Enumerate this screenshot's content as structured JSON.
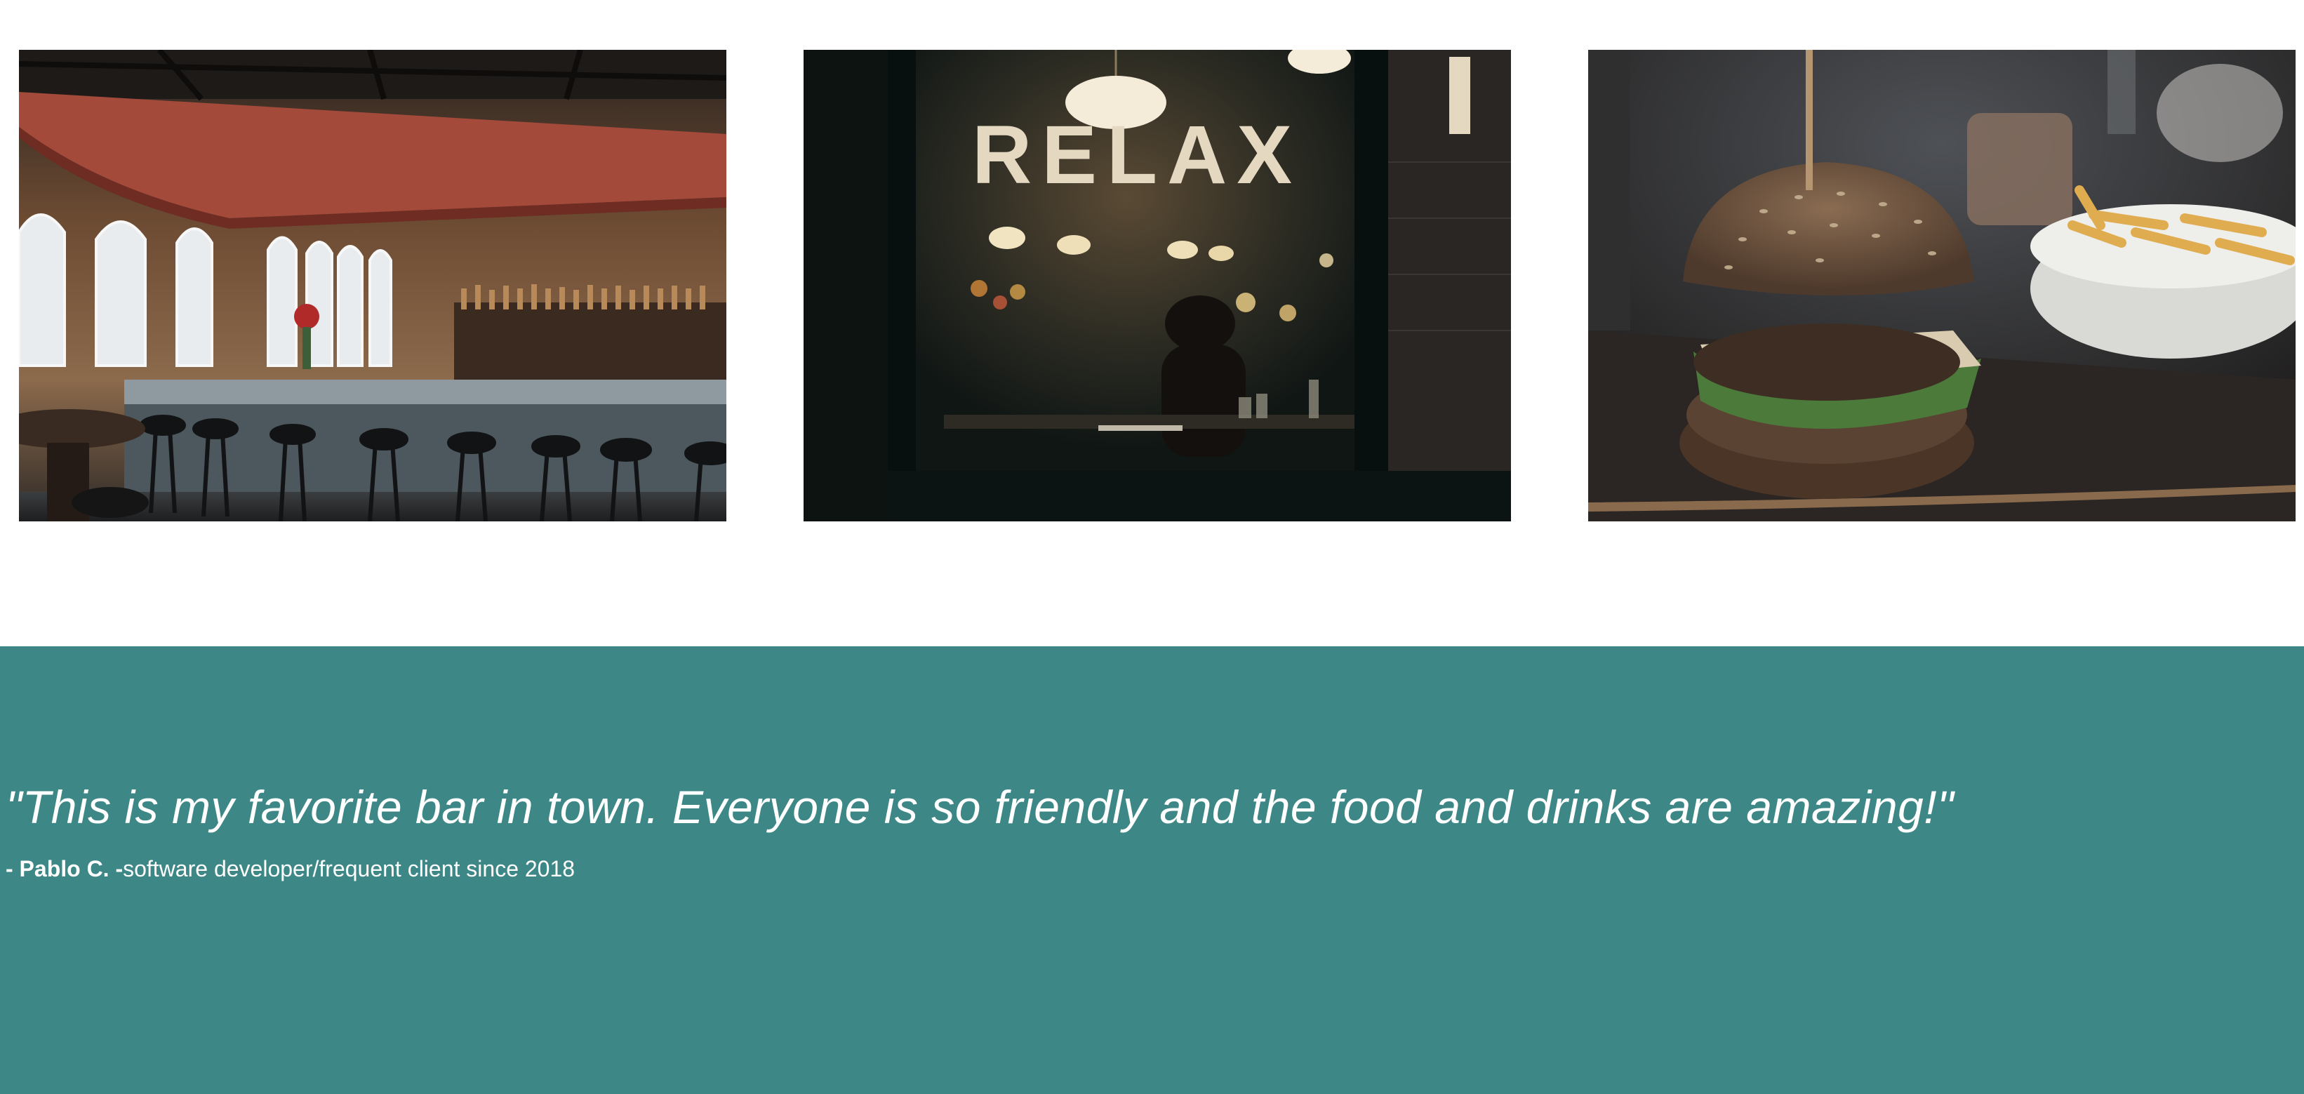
{
  "gallery": {
    "images": [
      {
        "alt": "bar-interior"
      },
      {
        "alt": "bar-window",
        "sign_text": "RELAX"
      },
      {
        "alt": "burger-and-fries"
      }
    ]
  },
  "testimonial": {
    "quote": "\"This is my favorite bar in town. Everyone is so friendly and the food and drinks are amazing!\"",
    "author": "- Pablo C. -",
    "role": "software developer/frequent client since 2018"
  },
  "colors": {
    "testimonial_bg": "#3d8787",
    "text": "#ffffff",
    "page_bg": "#ffffff"
  }
}
